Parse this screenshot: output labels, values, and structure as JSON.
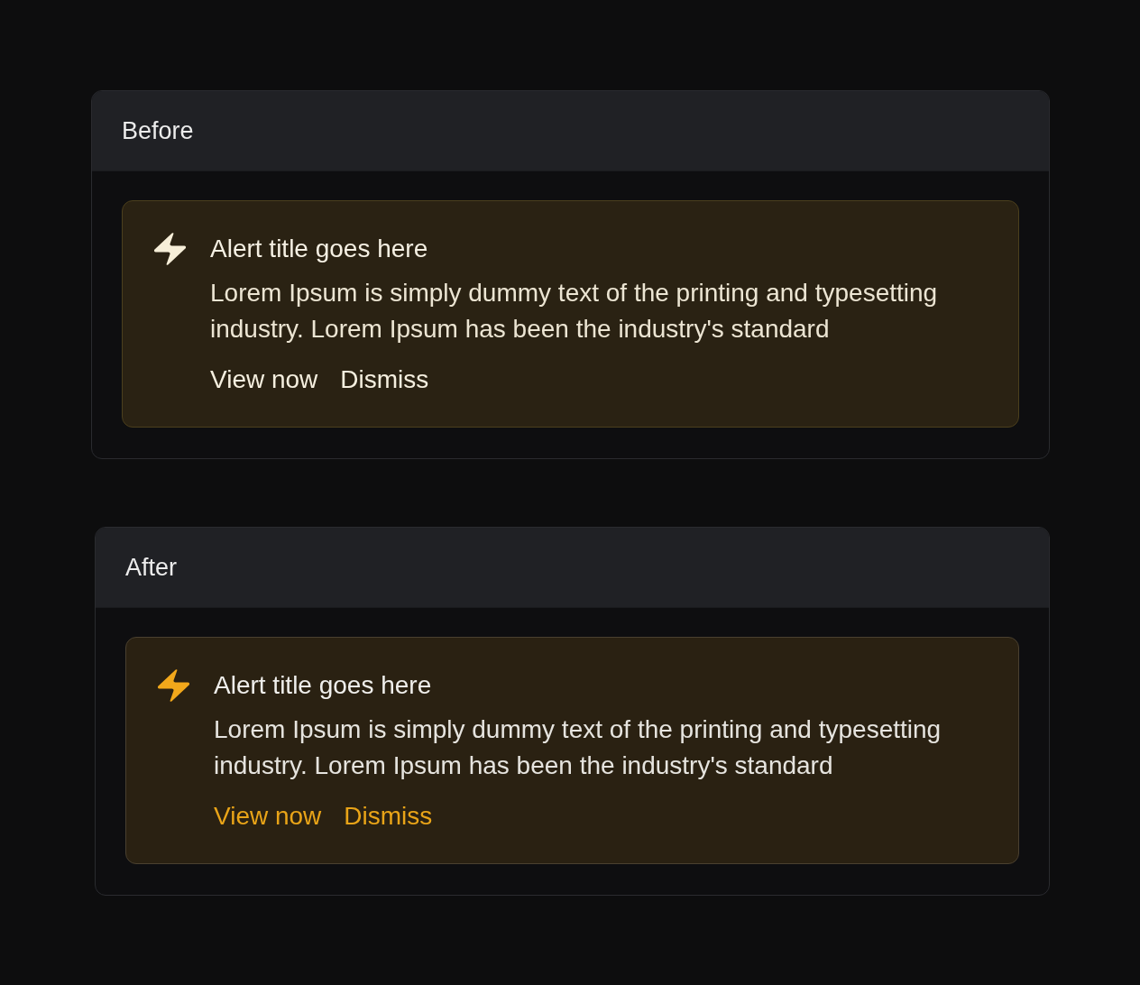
{
  "panels": [
    {
      "title": "Before",
      "kind": "monochrome",
      "alert": {
        "title": "Alert title goes here",
        "body": "Lorem Ipsum is simply dummy text of the printing and typesetting industry. Lorem Ipsum has been the industry's standard",
        "actions": [
          "View now",
          "Dismiss"
        ]
      }
    },
    {
      "title": "After",
      "kind": "accent",
      "alert": {
        "title": "Alert title goes here",
        "body": "Lorem Ipsum is simply dummy text of the printing and typesetting industry. Lorem Ipsum has been the industry's standard",
        "actions": [
          "View now",
          "Dismiss"
        ]
      }
    }
  ]
}
